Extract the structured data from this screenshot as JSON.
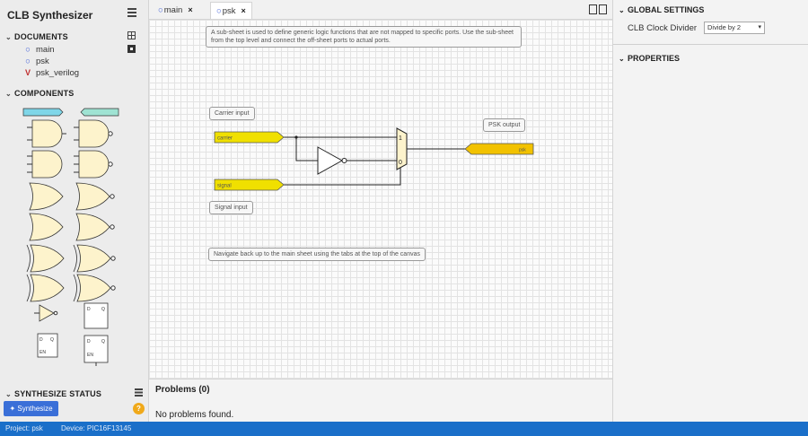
{
  "app": {
    "title": "CLB Synthesizer"
  },
  "sidebar": {
    "documents_header": "DOCUMENTS",
    "documents": [
      {
        "label": "main",
        "icon": "circle-icon"
      },
      {
        "label": "psk",
        "icon": "circle-icon"
      },
      {
        "label": "psk_verilog",
        "icon": "verilog-icon",
        "icon_glyph": "V"
      }
    ],
    "components_header": "COMPONENTS",
    "palette_ports": [
      "input-port-icon",
      "output-port-icon"
    ],
    "synth_status_header": "SYNTHESIZE STATUS",
    "synthesize_button": "Synthesize",
    "warning_count": "?"
  },
  "tabs": [
    {
      "label": "main",
      "close": "×",
      "active": false
    },
    {
      "label": "psk",
      "close": "×",
      "active": true
    }
  ],
  "canvas": {
    "comments": {
      "top": "A sub-sheet is used to define generic logic functions that are not mapped to specific ports. Use the sub-sheet from the top level and connect the off-sheet ports to actual ports.",
      "carrier": "Carrier input",
      "signal": "Signal input",
      "psk_output": "PSK output",
      "navigate": "Navigate back up to the main sheet using the tabs at the top of the canvas"
    },
    "ports": {
      "carrier": "carrier",
      "signal": "signal",
      "output": "psk"
    },
    "mux": {
      "in1": "1",
      "in0": "0"
    },
    "colors": {
      "port_fill": "#f0e000",
      "port_out_fill": "#f2c200",
      "wire": "#222222"
    }
  },
  "problems": {
    "header": "Problems (0)",
    "message": "No problems found."
  },
  "right_panel": {
    "global_settings_header": "GLOBAL SETTINGS",
    "clock_divider_label": "CLB Clock Divider",
    "clock_divider_value": "Divide by 2",
    "properties_header": "PROPERTIES"
  },
  "statusbar": {
    "project": "Project: psk",
    "device": "Device: PIC16F13145"
  },
  "colors": {
    "accent": "#3a6fd8",
    "statusbar": "#1a6fc9",
    "warning": "#f0a91a"
  }
}
